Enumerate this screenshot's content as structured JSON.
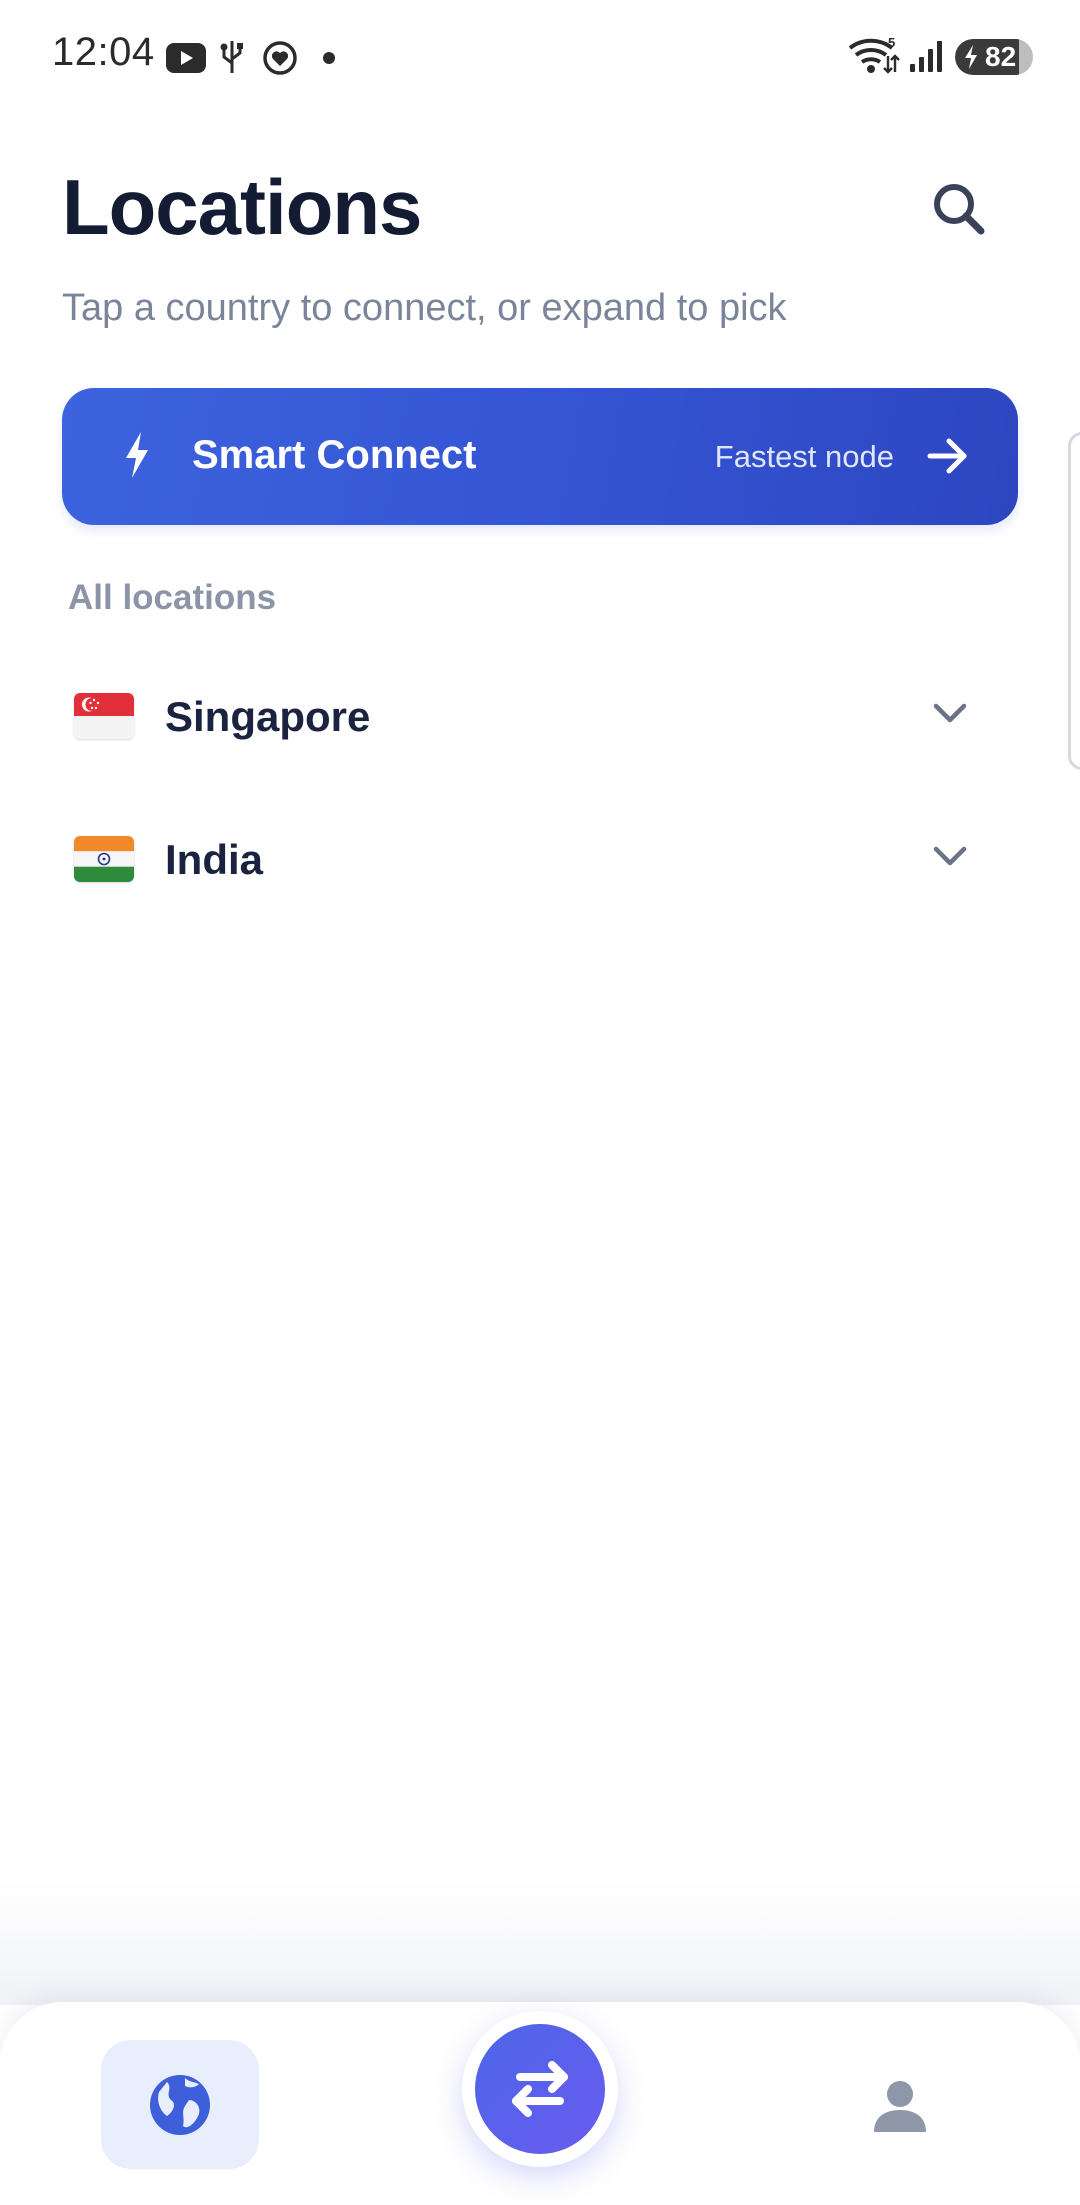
{
  "status_bar": {
    "time": "12:04",
    "battery_level": "82",
    "icons": [
      "youtube-icon",
      "usb-icon",
      "heart-badge-icon",
      "dot-icon",
      "wifi-icon",
      "signal-icon",
      "battery-icon"
    ]
  },
  "header": {
    "title": "Locations",
    "subtitle": "Tap a country to connect, or expand to pick",
    "search_icon": "search-icon"
  },
  "smart_connect": {
    "label": "Smart Connect",
    "sublabel": "Fastest node",
    "icon": "bolt-icon",
    "trailing_icon": "arrow-right-icon"
  },
  "section": {
    "label": "All locations"
  },
  "locations": [
    {
      "name": "Singapore",
      "flag": "singapore-flag-icon",
      "expand_icon": "chevron-down-icon"
    },
    {
      "name": "India",
      "flag": "india-flag-icon",
      "expand_icon": "chevron-down-icon"
    }
  ],
  "bottom_nav": {
    "tabs": [
      {
        "id": "locations",
        "icon": "globe-icon",
        "active": true
      },
      {
        "id": "connect",
        "icon": "swap-arrows-icon",
        "active": false
      },
      {
        "id": "profile",
        "icon": "person-icon",
        "active": false
      }
    ]
  },
  "colors": {
    "accent": "#3454d3",
    "title": "#141c33",
    "muted": "#7a8599",
    "fab": "#5b62ee",
    "nav_active_bg": "#e8eefc"
  }
}
